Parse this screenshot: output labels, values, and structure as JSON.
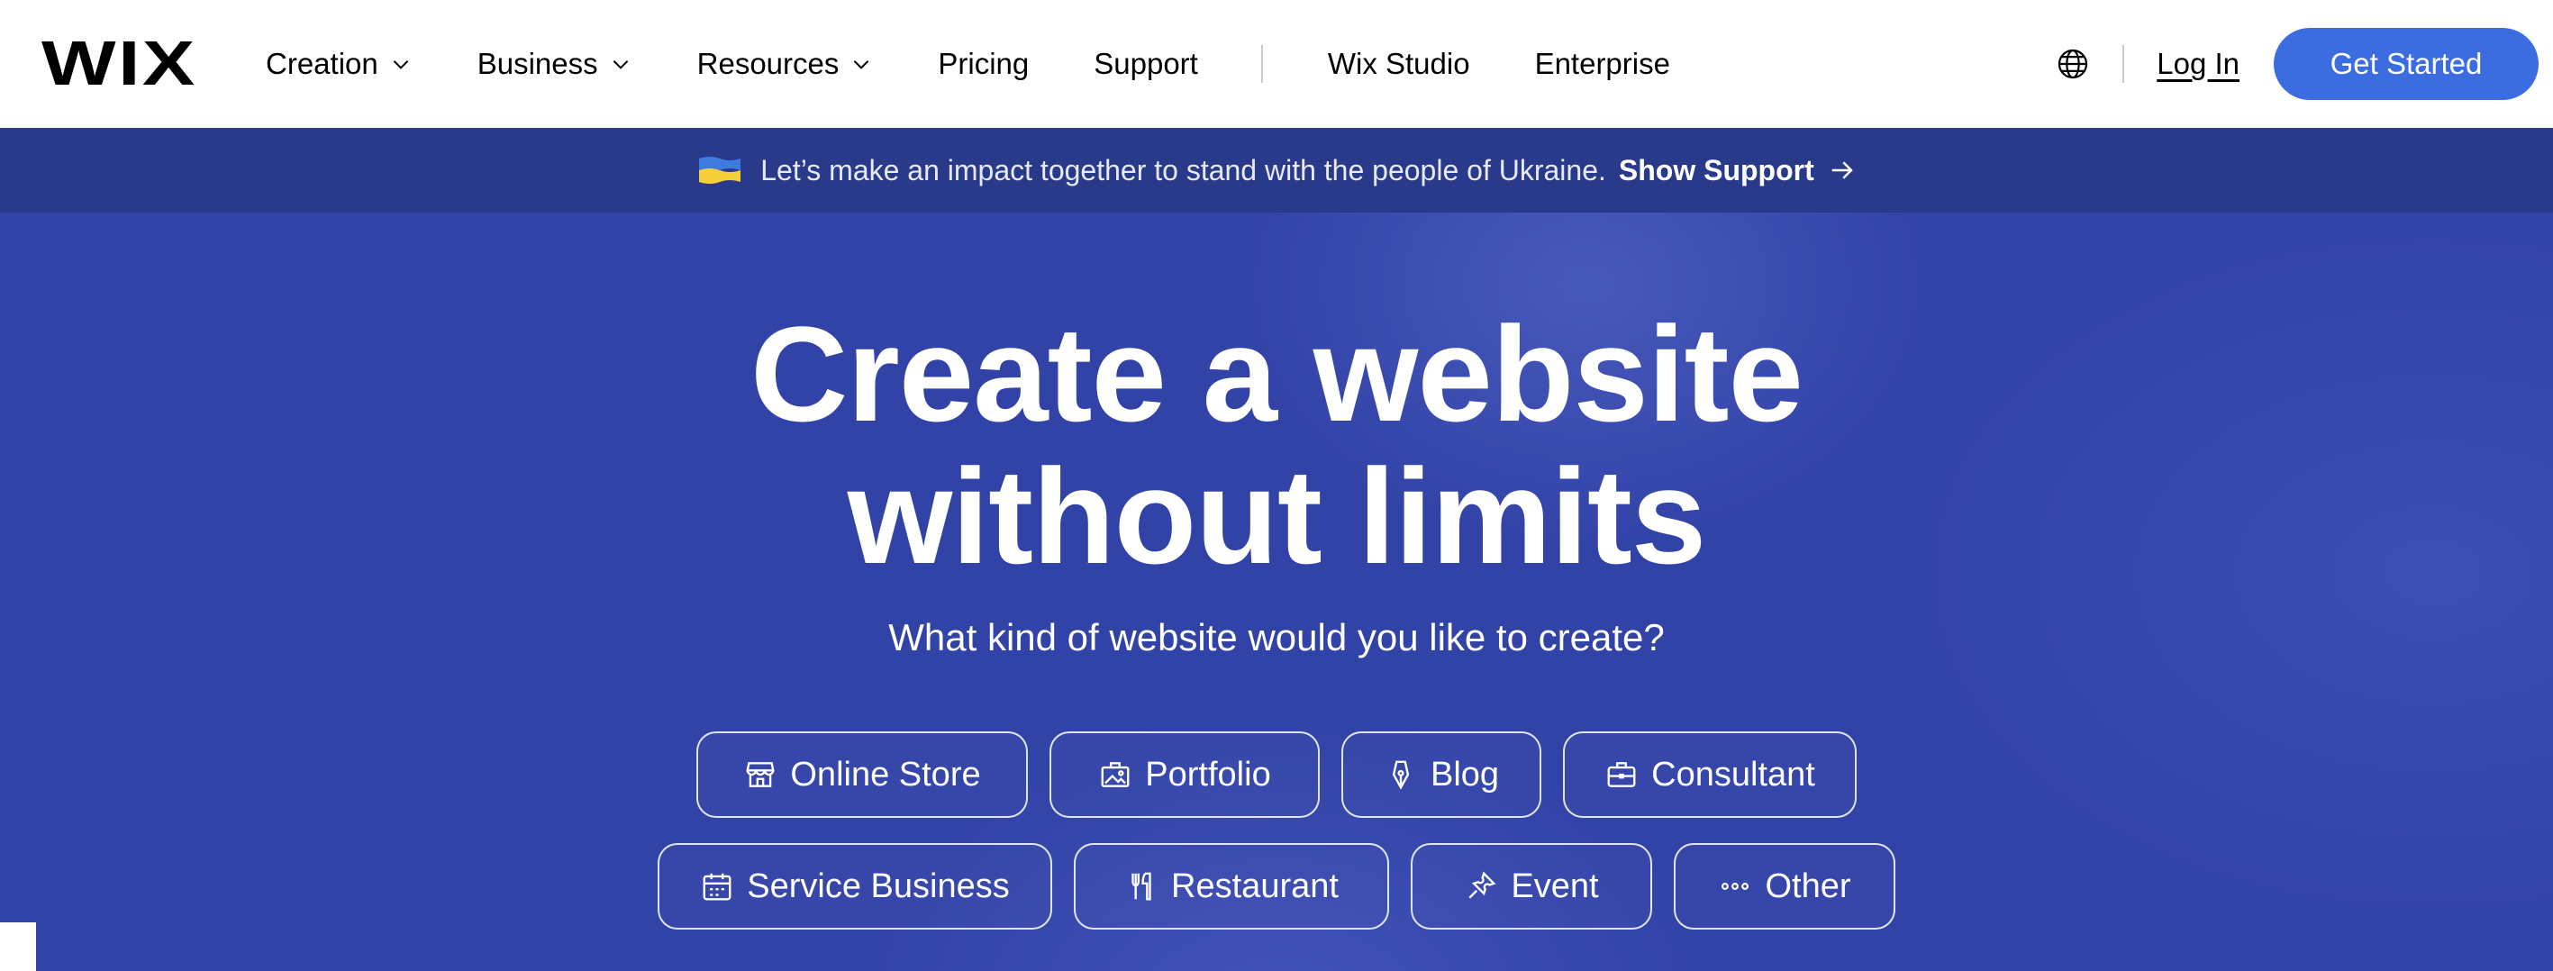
{
  "header": {
    "logo": "WIX",
    "nav": [
      {
        "label": "Creation",
        "dropdown": true
      },
      {
        "label": "Business",
        "dropdown": true
      },
      {
        "label": "Resources",
        "dropdown": true
      },
      {
        "label": "Pricing",
        "dropdown": false
      },
      {
        "label": "Support",
        "dropdown": false
      },
      {
        "label": "Wix Studio",
        "dropdown": false
      },
      {
        "label": "Enterprise",
        "dropdown": false
      }
    ],
    "login_label": "Log In",
    "get_started_label": "Get Started",
    "globe_icon": "globe-icon"
  },
  "banner": {
    "text": "Let’s make an impact together to stand with the people of Ukraine.",
    "link_label": "Show Support",
    "flag_icon": "ukraine-flag-icon"
  },
  "hero": {
    "title_line1": "Create a website",
    "title_line2": "without limits",
    "subtitle": "What kind of website would you like to create?",
    "chips_row1": [
      {
        "label": "Online Store",
        "icon": "store-icon"
      },
      {
        "label": "Portfolio",
        "icon": "portfolio-icon"
      },
      {
        "label": "Blog",
        "icon": "pen-icon"
      },
      {
        "label": "Consultant",
        "icon": "briefcase-icon"
      }
    ],
    "chips_row2": [
      {
        "label": "Service Business",
        "icon": "calendar-icon"
      },
      {
        "label": "Restaurant",
        "icon": "utensils-icon"
      },
      {
        "label": "Event",
        "icon": "ticket-icon"
      },
      {
        "label": "Other",
        "icon": "more-dots-icon"
      }
    ]
  },
  "colors": {
    "header_bg": "#ffffff",
    "banner_bg": "#2a3a8a",
    "hero_bg": "#3243a8",
    "cta_bg": "#3b6ce0"
  }
}
